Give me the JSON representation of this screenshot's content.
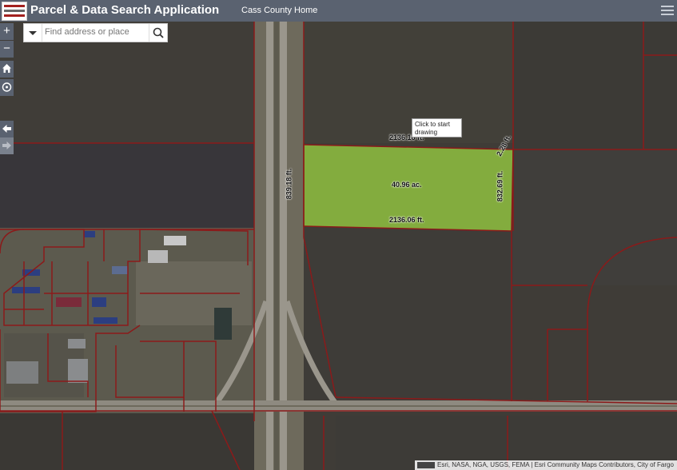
{
  "header": {
    "title": "Parcel & Data Search Application",
    "home_link": "Cass County Home",
    "logo_icon": "cass-county-seal"
  },
  "search": {
    "placeholder": "Find address or place",
    "dropdown_icon": "caret-down-icon",
    "search_icon": "magnifier-icon"
  },
  "map_controls": {
    "zoom_in": "+",
    "zoom_out": "−",
    "home_icon": "home-icon",
    "locate_icon": "locate-icon",
    "back_icon": "arrow-left-icon",
    "forward_icon": "arrow-right-icon"
  },
  "drawing": {
    "tooltip": "Click to start drawing",
    "top_length": "2136.16 ft.",
    "corner_length": "2.28 ft.",
    "left_length": "839.18 ft.",
    "right_length": "832.69 ft.",
    "bottom_length": "2136.06 ft.",
    "area": "40.96 ac."
  },
  "attribution": {
    "text": "Esri, NASA, NGA, USGS, FEMA | Esri Community Maps Contributors, City of Fargo"
  },
  "colors": {
    "header_bg": "#5a6270",
    "parcel_line": "#8b1a1a",
    "drawn_fill": "#8fbf3f"
  }
}
